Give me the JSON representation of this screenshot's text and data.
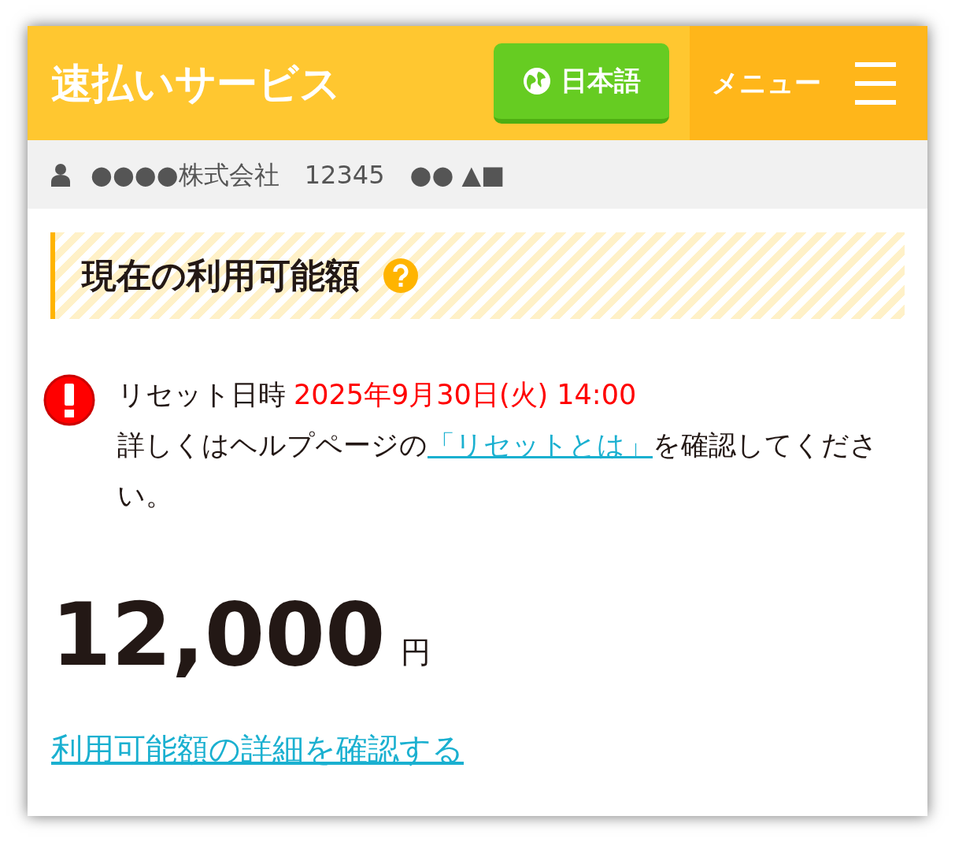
{
  "header": {
    "title": "速払いサービス",
    "language_button": "日本語",
    "menu_label": "メニュー"
  },
  "user_bar": {
    "company": "●●●●株式会社",
    "id": "12345",
    "name": "●● ▲■"
  },
  "section": {
    "heading": "現在の利用可能額"
  },
  "notice": {
    "reset_label": "リセット日時",
    "reset_datetime": "2025年9月30日(火) 14:00",
    "help_before": "詳しくはヘルプページの",
    "help_link": "「リセットとは」",
    "help_after": "を確認してください。"
  },
  "amount": {
    "value": "12,000",
    "unit": "円"
  },
  "details_link": "利用可能額の詳細を確認する"
}
